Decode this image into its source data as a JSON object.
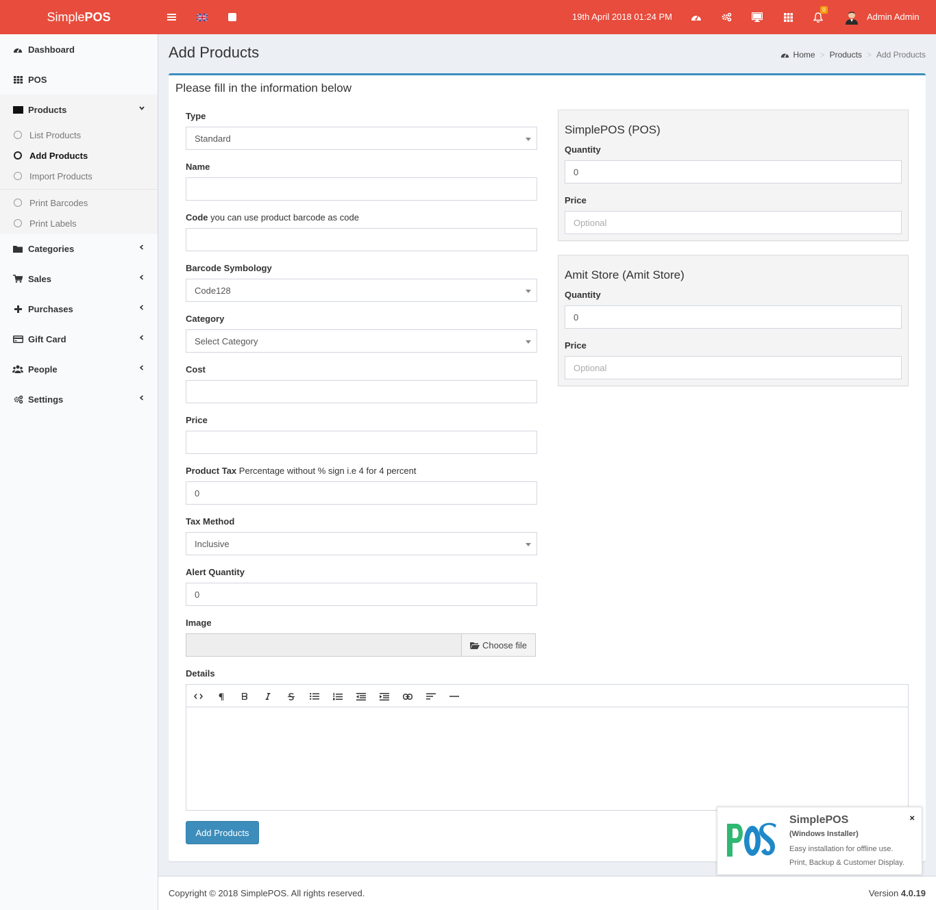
{
  "colors": {
    "brand": "#e74c3c",
    "primary": "#3c8dbc",
    "badge": "#f39c12",
    "promo_green": "#2eb872",
    "promo_blue": "#1e88c9"
  },
  "topbar": {
    "brand_light": "Simple",
    "brand_bold": "POS",
    "datetime": "19th April 2018 01:24 PM",
    "notification_count": "0",
    "user_name": "Admin Admin",
    "icons": [
      "menu-icon",
      "uk-flag-icon",
      "square-icon",
      "dashboard-icon",
      "cogs-icon",
      "desktop-icon",
      "grid-icon",
      "bell-icon"
    ]
  },
  "sidebar": {
    "items": [
      {
        "label": "Dashboard",
        "icon": "dashboard-icon"
      },
      {
        "label": "POS",
        "icon": "grid-icon"
      },
      {
        "label": "Products",
        "icon": "square-icon"
      },
      {
        "label": "Categories",
        "icon": "folder-icon"
      },
      {
        "label": "Sales",
        "icon": "cart-icon"
      },
      {
        "label": "Purchases",
        "icon": "plus-icon"
      },
      {
        "label": "Gift Card",
        "icon": "credit-card-icon"
      },
      {
        "label": "People",
        "icon": "users-icon"
      },
      {
        "label": "Settings",
        "icon": "cogs-icon"
      }
    ],
    "sub": [
      {
        "label": "List Products"
      },
      {
        "label": "Add Products"
      },
      {
        "label": "Import Products"
      },
      {
        "label": "Print Barcodes"
      },
      {
        "label": "Print Labels"
      }
    ]
  },
  "page": {
    "title": "Add Products",
    "breadcrumb": [
      "Home",
      "Products",
      "Add Products"
    ],
    "box_title": "Please fill in the information below"
  },
  "form": {
    "type": {
      "label": "Type",
      "value": "Standard"
    },
    "name": {
      "label": "Name",
      "value": ""
    },
    "code": {
      "label": "Code",
      "help": "you can use product barcode as code",
      "value": ""
    },
    "barcode": {
      "label": "Barcode Symbology",
      "value": "Code128"
    },
    "category": {
      "label": "Category",
      "value": "Select Category"
    },
    "cost": {
      "label": "Cost",
      "value": ""
    },
    "price": {
      "label": "Price",
      "value": ""
    },
    "tax": {
      "label": "Product Tax",
      "help": "Percentage without % sign i.e 4 for 4 percent",
      "value": "0"
    },
    "tax_method": {
      "label": "Tax Method",
      "value": "Inclusive"
    },
    "alert_qty": {
      "label": "Alert Quantity",
      "value": "0"
    },
    "image": {
      "label": "Image",
      "button": "Choose file"
    },
    "details": {
      "label": "Details"
    },
    "submit": "Add Products"
  },
  "stores": [
    {
      "title": "SimplePOS (POS)",
      "qty_label": "Quantity",
      "qty_value": "0",
      "price_label": "Price",
      "price_placeholder": "Optional"
    },
    {
      "title": "Amit Store (Amit Store)",
      "qty_label": "Quantity",
      "qty_value": "0",
      "price_label": "Price",
      "price_placeholder": "Optional"
    }
  ],
  "editor_toolbar": [
    "code-view-icon",
    "paragraph-icon",
    "bold-icon",
    "italic-icon",
    "strikethrough-icon",
    "unordered-list-icon",
    "ordered-list-icon",
    "outdent-icon",
    "indent-icon",
    "link-icon",
    "align-left-icon",
    "horizontal-rule-icon"
  ],
  "footer": {
    "copyright": "Copyright © 2018 SimplePOS. All rights reserved.",
    "version_label": "Version",
    "version": "4.0.19"
  },
  "promo": {
    "logo": "POS",
    "name": "SimplePOS",
    "subtitle": "(Windows Installer)",
    "line1": "Easy installation for offline use.",
    "line2": "Print, Backup & Customer Display.",
    "close": "×"
  }
}
